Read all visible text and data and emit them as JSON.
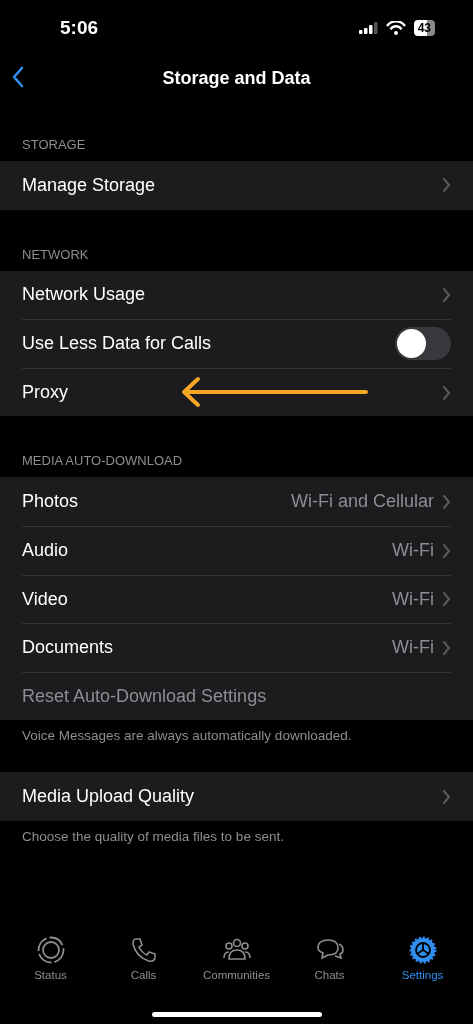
{
  "status_bar": {
    "time": "5:06",
    "battery": "43"
  },
  "nav": {
    "title": "Storage and Data"
  },
  "sections": [
    {
      "header": "STORAGE",
      "rows": [
        {
          "kind": "link",
          "label": "Manage Storage"
        }
      ]
    },
    {
      "header": "NETWORK",
      "rows": [
        {
          "kind": "link",
          "label": "Network Usage"
        },
        {
          "kind": "toggle",
          "label": "Use Less Data for Calls",
          "on": false
        },
        {
          "kind": "link",
          "label": "Proxy",
          "annotated": true
        }
      ]
    },
    {
      "header": "MEDIA AUTO-DOWNLOAD",
      "rows": [
        {
          "kind": "link",
          "label": "Photos",
          "value": "Wi-Fi and Cellular"
        },
        {
          "kind": "link",
          "label": "Audio",
          "value": "Wi-Fi"
        },
        {
          "kind": "link",
          "label": "Video",
          "value": "Wi-Fi"
        },
        {
          "kind": "link",
          "label": "Documents",
          "value": "Wi-Fi"
        },
        {
          "kind": "action",
          "label": "Reset Auto-Download Settings",
          "disabled": true
        }
      ],
      "footer": "Voice Messages are always automatically downloaded."
    },
    {
      "rows": [
        {
          "kind": "link",
          "label": "Media Upload Quality"
        }
      ],
      "footer": "Choose the quality of media files to be sent."
    }
  ],
  "tabs": [
    {
      "label": "Status",
      "kind": "status",
      "selected": false
    },
    {
      "label": "Calls",
      "kind": "calls",
      "selected": false
    },
    {
      "label": "Communities",
      "kind": "communities",
      "selected": false
    },
    {
      "label": "Chats",
      "kind": "chats",
      "selected": false
    },
    {
      "label": "Settings",
      "kind": "settings",
      "selected": true
    }
  ]
}
